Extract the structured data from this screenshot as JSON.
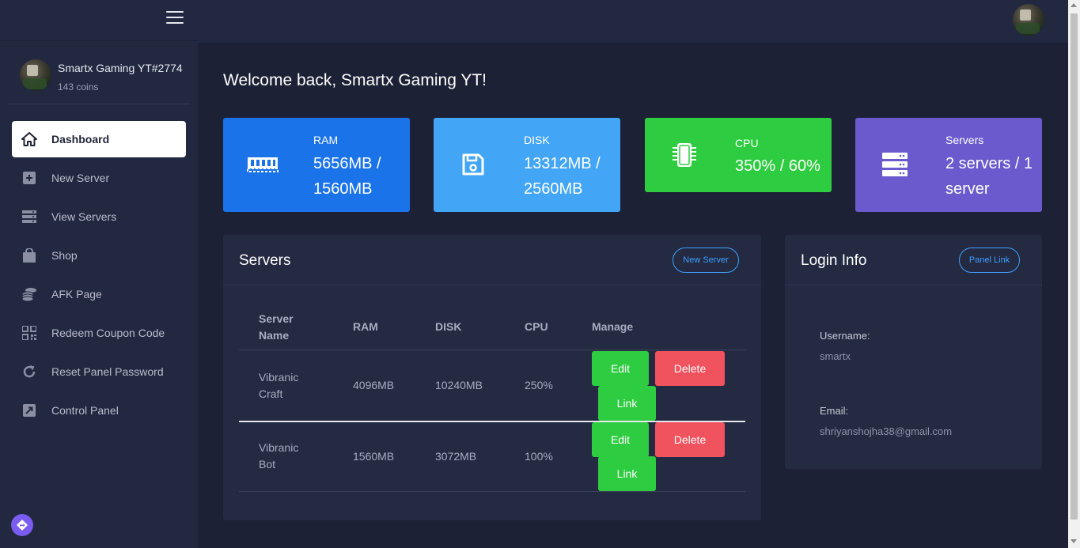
{
  "profile": {
    "name": "Smartx Gaming YT#2774",
    "coins": "143 coins"
  },
  "nav": [
    {
      "label": "Dashboard",
      "icon": "home-icon",
      "active": true
    },
    {
      "label": "New Server",
      "icon": "plus-square-icon"
    },
    {
      "label": "View Servers",
      "icon": "server-icon"
    },
    {
      "label": "Shop",
      "icon": "shopping-bag-icon"
    },
    {
      "label": "AFK Page",
      "icon": "coins-icon"
    },
    {
      "label": "Redeem Coupon Code",
      "icon": "qr-code-icon"
    },
    {
      "label": "Reset Panel Password",
      "icon": "refresh-icon"
    },
    {
      "label": "Control Panel",
      "icon": "external-link-icon"
    }
  ],
  "welcome": "Welcome back, Smartx Gaming YT!",
  "stats": {
    "ram": {
      "label": "RAM",
      "value": "5656MB / 1560MB",
      "color": "#1a73e8"
    },
    "disk": {
      "label": "DISK",
      "value": "13312MB / 2560MB",
      "color": "#42a5f5"
    },
    "cpu": {
      "label": "CPU",
      "value": "350% / 60%",
      "color": "#2ecc40"
    },
    "servers": {
      "label": "Servers",
      "value": "2 servers / 1 server",
      "color": "#6a5acd"
    }
  },
  "servers_card": {
    "title": "Servers",
    "new_server_label": "New Server",
    "columns": [
      "Server Name",
      "RAM",
      "DISK",
      "CPU",
      "Manage"
    ],
    "rows": [
      {
        "name": "Vibranic Craft",
        "ram": "4096MB",
        "disk": "10240MB",
        "cpu": "250%",
        "edit": "Edit",
        "delete": "Delete",
        "link": "Link"
      },
      {
        "name": "Vibranic Bot",
        "ram": "1560MB",
        "disk": "3072MB",
        "cpu": "100%",
        "edit": "Edit",
        "delete": "Delete",
        "link": "Link"
      }
    ]
  },
  "login_card": {
    "title": "Login Info",
    "panel_link_label": "Panel Link",
    "username_label": "Username:",
    "username": "smartx",
    "email_label": "Email:",
    "email": "shriyanshojha38@gmail.com"
  },
  "colors": {
    "edit": "#2ecc40",
    "delete": "#f0525e",
    "accent": "#3fa0ff"
  }
}
